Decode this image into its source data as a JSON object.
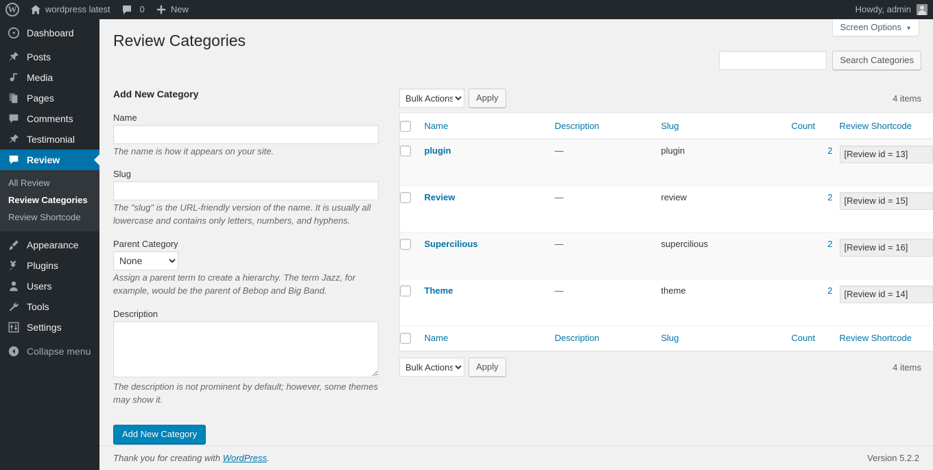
{
  "adminbar": {
    "logo_icon": "wordpress-logo-icon",
    "site_name": "wordpress latest",
    "site_icon": "home-icon",
    "comments_icon": "comment-bubble-icon",
    "comments_count": "0",
    "new_icon": "plus-icon",
    "new_label": "New",
    "howdy": "Howdy, admin",
    "avatar": "user-avatar"
  },
  "sidebar": {
    "items": [
      {
        "label": "Dashboard",
        "icon": "dashboard-icon",
        "current": false
      },
      {
        "label": "Posts",
        "icon": "pin-icon",
        "current": false
      },
      {
        "label": "Media",
        "icon": "media-icon",
        "current": false
      },
      {
        "label": "Pages",
        "icon": "pages-icon",
        "current": false
      },
      {
        "label": "Comments",
        "icon": "comment-bubble-icon",
        "current": false
      },
      {
        "label": "Testimonial",
        "icon": "pin-icon",
        "current": false
      },
      {
        "label": "Review",
        "icon": "comment-bubble-icon",
        "current": true
      }
    ],
    "submenu": [
      {
        "label": "All Review",
        "current": false
      },
      {
        "label": "Review Categories",
        "current": true
      },
      {
        "label": "Review Shortcode",
        "current": false
      }
    ],
    "items2": [
      {
        "label": "Appearance",
        "icon": "brush-icon",
        "current": false
      },
      {
        "label": "Plugins",
        "icon": "plug-icon",
        "current": false
      },
      {
        "label": "Users",
        "icon": "user-icon",
        "current": false
      },
      {
        "label": "Tools",
        "icon": "wrench-icon",
        "current": false
      },
      {
        "label": "Settings",
        "icon": "sliders-icon",
        "current": false
      }
    ],
    "collapse": {
      "label": "Collapse menu",
      "icon": "collapse-arrow-icon"
    }
  },
  "screen_meta": {
    "screen_options_label": "Screen Options",
    "caret": "▼"
  },
  "page": {
    "title": "Review Categories"
  },
  "search": {
    "value": "",
    "placeholder": "",
    "button_label": "Search Categories"
  },
  "form": {
    "heading": "Add New Category",
    "name_label": "Name",
    "name_value": "",
    "name_help": "The name is how it appears on your site.",
    "slug_label": "Slug",
    "slug_value": "",
    "slug_help": "The \"slug\" is the URL-friendly version of the name. It is usually all lowercase and contains only letters, numbers, and hyphens.",
    "parent_label": "Parent Category",
    "parent_value": "None",
    "parent_options": [
      "None"
    ],
    "parent_help": "Assign a parent term to create a hierarchy. The term Jazz, for example, would be the parent of Bebop and Big Band.",
    "description_label": "Description",
    "description_value": "",
    "description_help": "The description is not prominent by default; however, some themes may show it.",
    "submit_label": "Add New Category"
  },
  "tablenav_top": {
    "bulk_value": "Bulk Actions",
    "bulk_options": [
      "Bulk Actions"
    ],
    "apply_label": "Apply",
    "displaying_num": "4 items"
  },
  "tablenav_bottom": {
    "bulk_value": "Bulk Actions",
    "bulk_options": [
      "Bulk Actions"
    ],
    "apply_label": "Apply",
    "displaying_num": "4 items"
  },
  "table": {
    "columns": {
      "name": "Name",
      "description": "Description",
      "slug": "Slug",
      "count": "Count",
      "shortcode": "Review Shortcode"
    },
    "rows": [
      {
        "name": "plugin",
        "description": "—",
        "slug": "plugin",
        "count": "2",
        "shortcode": "[Review id = 13]"
      },
      {
        "name": "Review",
        "description": "—",
        "slug": "review",
        "count": "2",
        "shortcode": "[Review id = 15]"
      },
      {
        "name": "Supercilious",
        "description": "—",
        "slug": "supercilious",
        "count": "2",
        "shortcode": "[Review id = 16]"
      },
      {
        "name": "Theme",
        "description": "—",
        "slug": "theme",
        "count": "2",
        "shortcode": "[Review id = 14]"
      }
    ]
  },
  "footer": {
    "thankyou_prefix": "Thank you for creating with ",
    "thankyou_link": "WordPress",
    "thankyou_suffix": ".",
    "version": "Version 5.2.2"
  },
  "colors": {
    "admin_dark": "#23282d",
    "admin_submenu": "#32373c",
    "accent_blue": "#0073aa",
    "link_blue": "#0073aa",
    "primary_button": "#0085ba",
    "page_bg": "#f1f1f1"
  }
}
